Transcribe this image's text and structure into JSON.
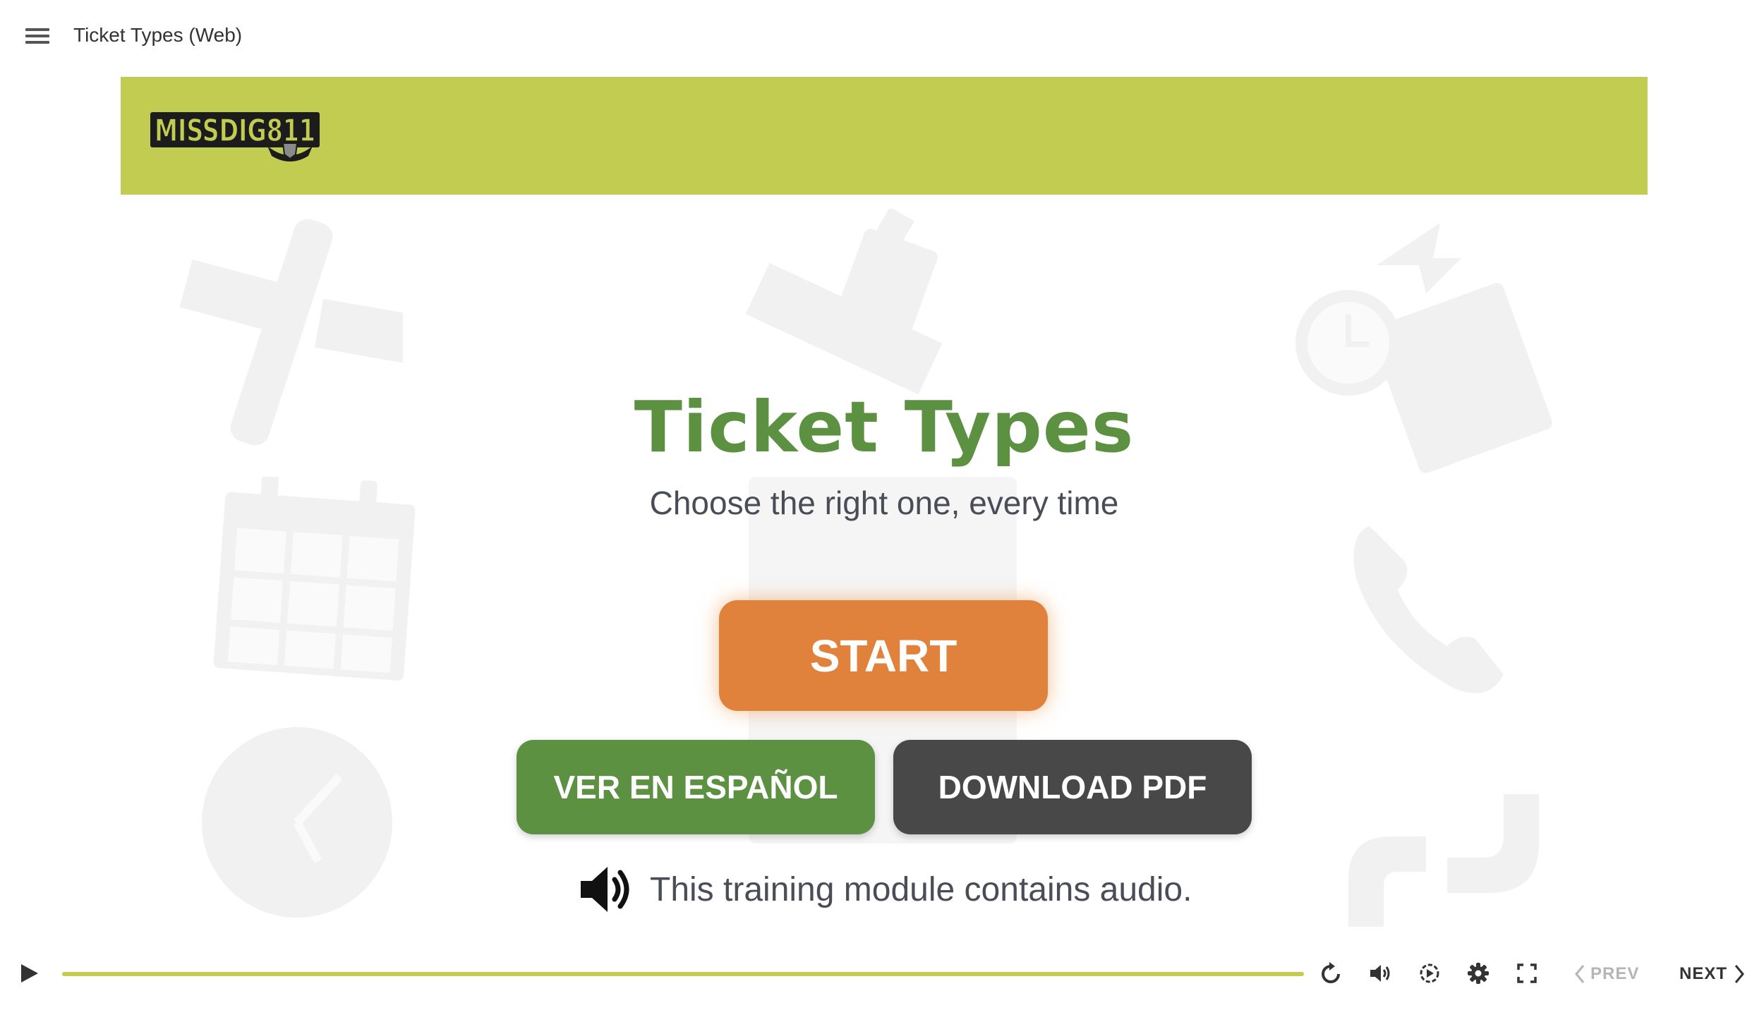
{
  "header": {
    "title": "Ticket Types (Web)"
  },
  "banner": {
    "logo_text": "MISS DIG 811",
    "color": "#c2cc50"
  },
  "hero": {
    "title": "Ticket Types",
    "subtitle": "Choose the right one, every time"
  },
  "buttons": {
    "start": "START",
    "spanish": "VER EN ESPAÑOL",
    "pdf": "DOWNLOAD PDF"
  },
  "audio_note": "This training module contains audio.",
  "player": {
    "progress": 1.0,
    "prev_label": "PREV",
    "next_label": "NEXT",
    "icons": [
      "play-icon",
      "replay-icon",
      "volume-icon",
      "playback-speed-icon",
      "settings-icon",
      "fullscreen-icon"
    ]
  },
  "colors": {
    "green": "#5b9140",
    "lime": "#c2cc50",
    "orange": "#e0823b",
    "dark": "#484848"
  }
}
